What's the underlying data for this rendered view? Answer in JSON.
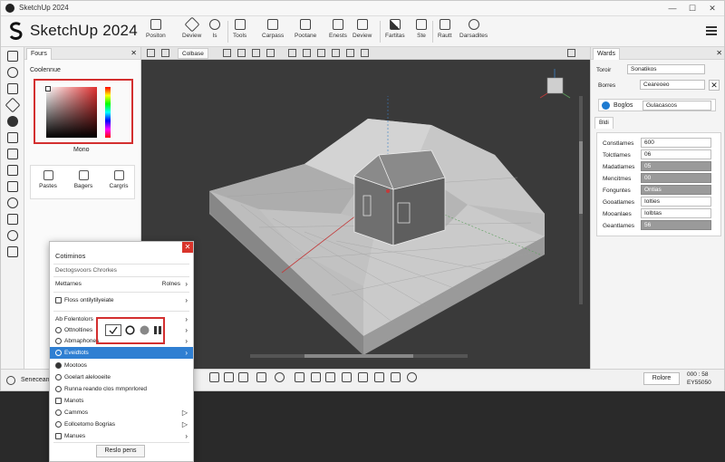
{
  "window": {
    "title": "SketchUp 2024"
  },
  "app": {
    "brand": "SketchUp 2024"
  },
  "toolbar": {
    "items": [
      "Positon",
      "Deview",
      "Is",
      "Tools",
      "Carpass",
      "Pootane",
      "Enests",
      "Deview",
      "Fartitas",
      "Ste",
      "Rautt",
      "Darsadites"
    ]
  },
  "left_panel": {
    "tab": "Fours",
    "color_label": "Coolennue",
    "color_name": "Mono",
    "materials": [
      "Pastes",
      "Bagers",
      "Cargris"
    ]
  },
  "viewport": {
    "tab": "Colbase"
  },
  "right_panel": {
    "tab": "Wards",
    "fields": [
      {
        "label": "Toroir",
        "value": "Sonatikos"
      },
      {
        "label": "Borres",
        "value": "Ceareoeo"
      }
    ],
    "chip_label": "Boglos",
    "chip_value": "Gulacascos",
    "entity": {
      "tab": "Bldi",
      "rows": [
        {
          "label": "Constlames",
          "value": "600"
        },
        {
          "label": "Tolctlames",
          "value": "06"
        },
        {
          "label": "Madatlames",
          "value": "05"
        },
        {
          "label": "Mencitmes",
          "value": "00"
        },
        {
          "label": "Fonguntes",
          "value": "Ontias"
        },
        {
          "label": "Gooatlames",
          "value": "Iolties"
        },
        {
          "label": "Mooanlaes",
          "value": "Iolbtas"
        },
        {
          "label": "Geantlames",
          "value": "56"
        }
      ]
    }
  },
  "statusbar": {
    "text": "Senecean",
    "button": "Rolore",
    "coord_a": "000 : 58",
    "coord_b": "EY55050"
  },
  "menu": {
    "title": "Cotiminos",
    "subtitle": "Dectogsvoors Chrorkes",
    "items": [
      {
        "label": "Mettarnes",
        "value": "Rolnes"
      },
      {
        "label": "Floss ontilytilyeiate"
      },
      {
        "label": "Ab Folentolors"
      },
      {
        "label": "Ottnoltines"
      },
      {
        "label": "Abmaphones"
      },
      {
        "label": "Eveidtots"
      },
      {
        "label": "Mootoos"
      },
      {
        "label": "Goelart alelooeite"
      },
      {
        "label": "Runna reando clos mmpnrlored"
      },
      {
        "label": "Manots"
      },
      {
        "label": "Cammos"
      },
      {
        "label": "Eollcetomo Bogrias"
      },
      {
        "label": "Manues"
      }
    ],
    "button": "Reslo pens"
  }
}
